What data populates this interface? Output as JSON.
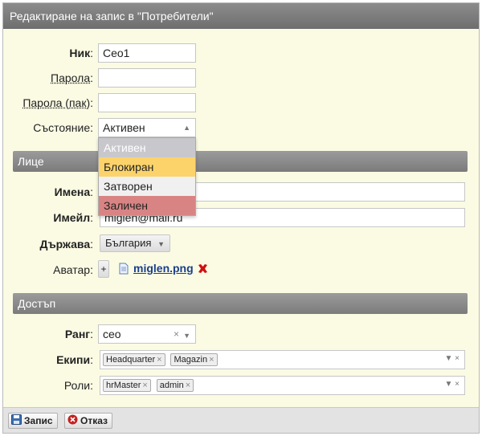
{
  "dialog": {
    "title": "Редактиране на запис в \"Потребители\""
  },
  "form": {
    "nick": {
      "label": "Ник",
      "value": "Ceo1"
    },
    "password": {
      "label": "Парола",
      "value": ""
    },
    "password_repeat": {
      "label": "Парола (пак)",
      "value": ""
    },
    "state": {
      "label": "Състояние",
      "selected": "Активен",
      "options": [
        {
          "label": "Активен",
          "color": "#c8c8cc"
        },
        {
          "label": "Блокиран",
          "color": "#fcd36b"
        },
        {
          "label": "Затворен",
          "color": "#f0f0f0"
        },
        {
          "label": "Заличен",
          "color": "#d98484"
        }
      ]
    }
  },
  "person": {
    "section_title": "Лице",
    "names": {
      "label": "Имена",
      "value": ""
    },
    "email": {
      "label": "Имейл",
      "value": "miglen@mail.ru"
    },
    "country": {
      "label": "Държава",
      "value": "България"
    },
    "avatar": {
      "label": "Аватар",
      "add": "+",
      "file": "miglen.png"
    }
  },
  "access": {
    "section_title": "Достъп",
    "rank": {
      "label": "Ранг",
      "value": "ceo"
    },
    "teams": {
      "label": "Екипи",
      "tags": [
        "Headquarter",
        "Magazin"
      ]
    },
    "roles": {
      "label": "Роли",
      "tags": [
        "hrMaster",
        "admin"
      ]
    }
  },
  "footer": {
    "save": "Запис",
    "cancel": "Отказ"
  },
  "colors": {
    "accent_link": "#1a3f8c",
    "delete": "#d01010"
  }
}
